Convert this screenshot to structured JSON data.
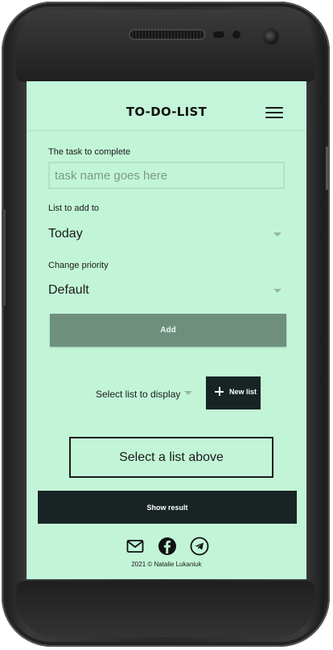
{
  "header": {
    "title": "TO-DO-LIST",
    "menu_icon": "hamburger-menu-icon"
  },
  "form": {
    "task_label": "The task to complete",
    "task_placeholder": "task name goes here",
    "task_value": "",
    "list_label": "List to add to",
    "list_selected": "Today",
    "priority_label": "Change priority",
    "priority_selected": "Default",
    "add_button": "Add"
  },
  "lists": {
    "select_label": "Select list to display",
    "new_list_button": "New list",
    "new_list_icon": "plus-icon"
  },
  "result": {
    "placeholder_text": "Select a list above",
    "show_result_button": "Show result"
  },
  "footer": {
    "icons": [
      "email-icon",
      "facebook-icon",
      "telegram-icon"
    ],
    "copyright": "2021 © Natalie Lukaniuk"
  },
  "colors": {
    "screen_background": "#c2f5d8",
    "add_button": "#6e8f7e",
    "dark_button": "#182424"
  }
}
